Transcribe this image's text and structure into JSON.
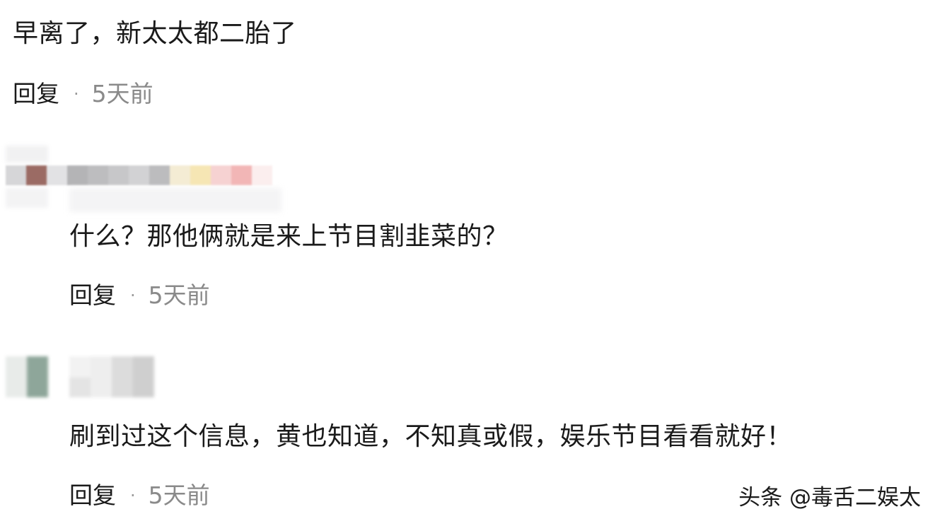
{
  "comments": [
    {
      "text": "早离了，新太太都二胎了",
      "reply_label": "回复",
      "separator": "·",
      "time": "5天前"
    },
    {
      "text": "什么？那他俩就是来上节目割韭菜的？",
      "reply_label": "回复",
      "separator": "·",
      "time": "5天前"
    },
    {
      "text": "刷到过这个信息，黄也知道，不知真或假，娱乐节目看看就好！",
      "reply_label": "回复",
      "separator": "·",
      "time": "5天前"
    }
  ],
  "watermark": "头条 @毒舌二娱太",
  "blurred_username_colors": {
    "comment_2": [
      "#d6d6d8",
      "#9b6b64",
      "#e2e2e4",
      "#b4b4b6",
      "#bdbdbf",
      "#c7c7c9",
      "#d2d2d4",
      "#bcbcbe",
      "#f4ecd4",
      "#f6e6b4",
      "#f6d2d2",
      "#f2b6b6",
      "#fbeeee"
    ],
    "comment_3": [
      "#e9ecea",
      "#8ea69a",
      "#f4f4f4",
      "#e6e6e6",
      "#dcdcdc",
      "#cfcfcf"
    ]
  }
}
